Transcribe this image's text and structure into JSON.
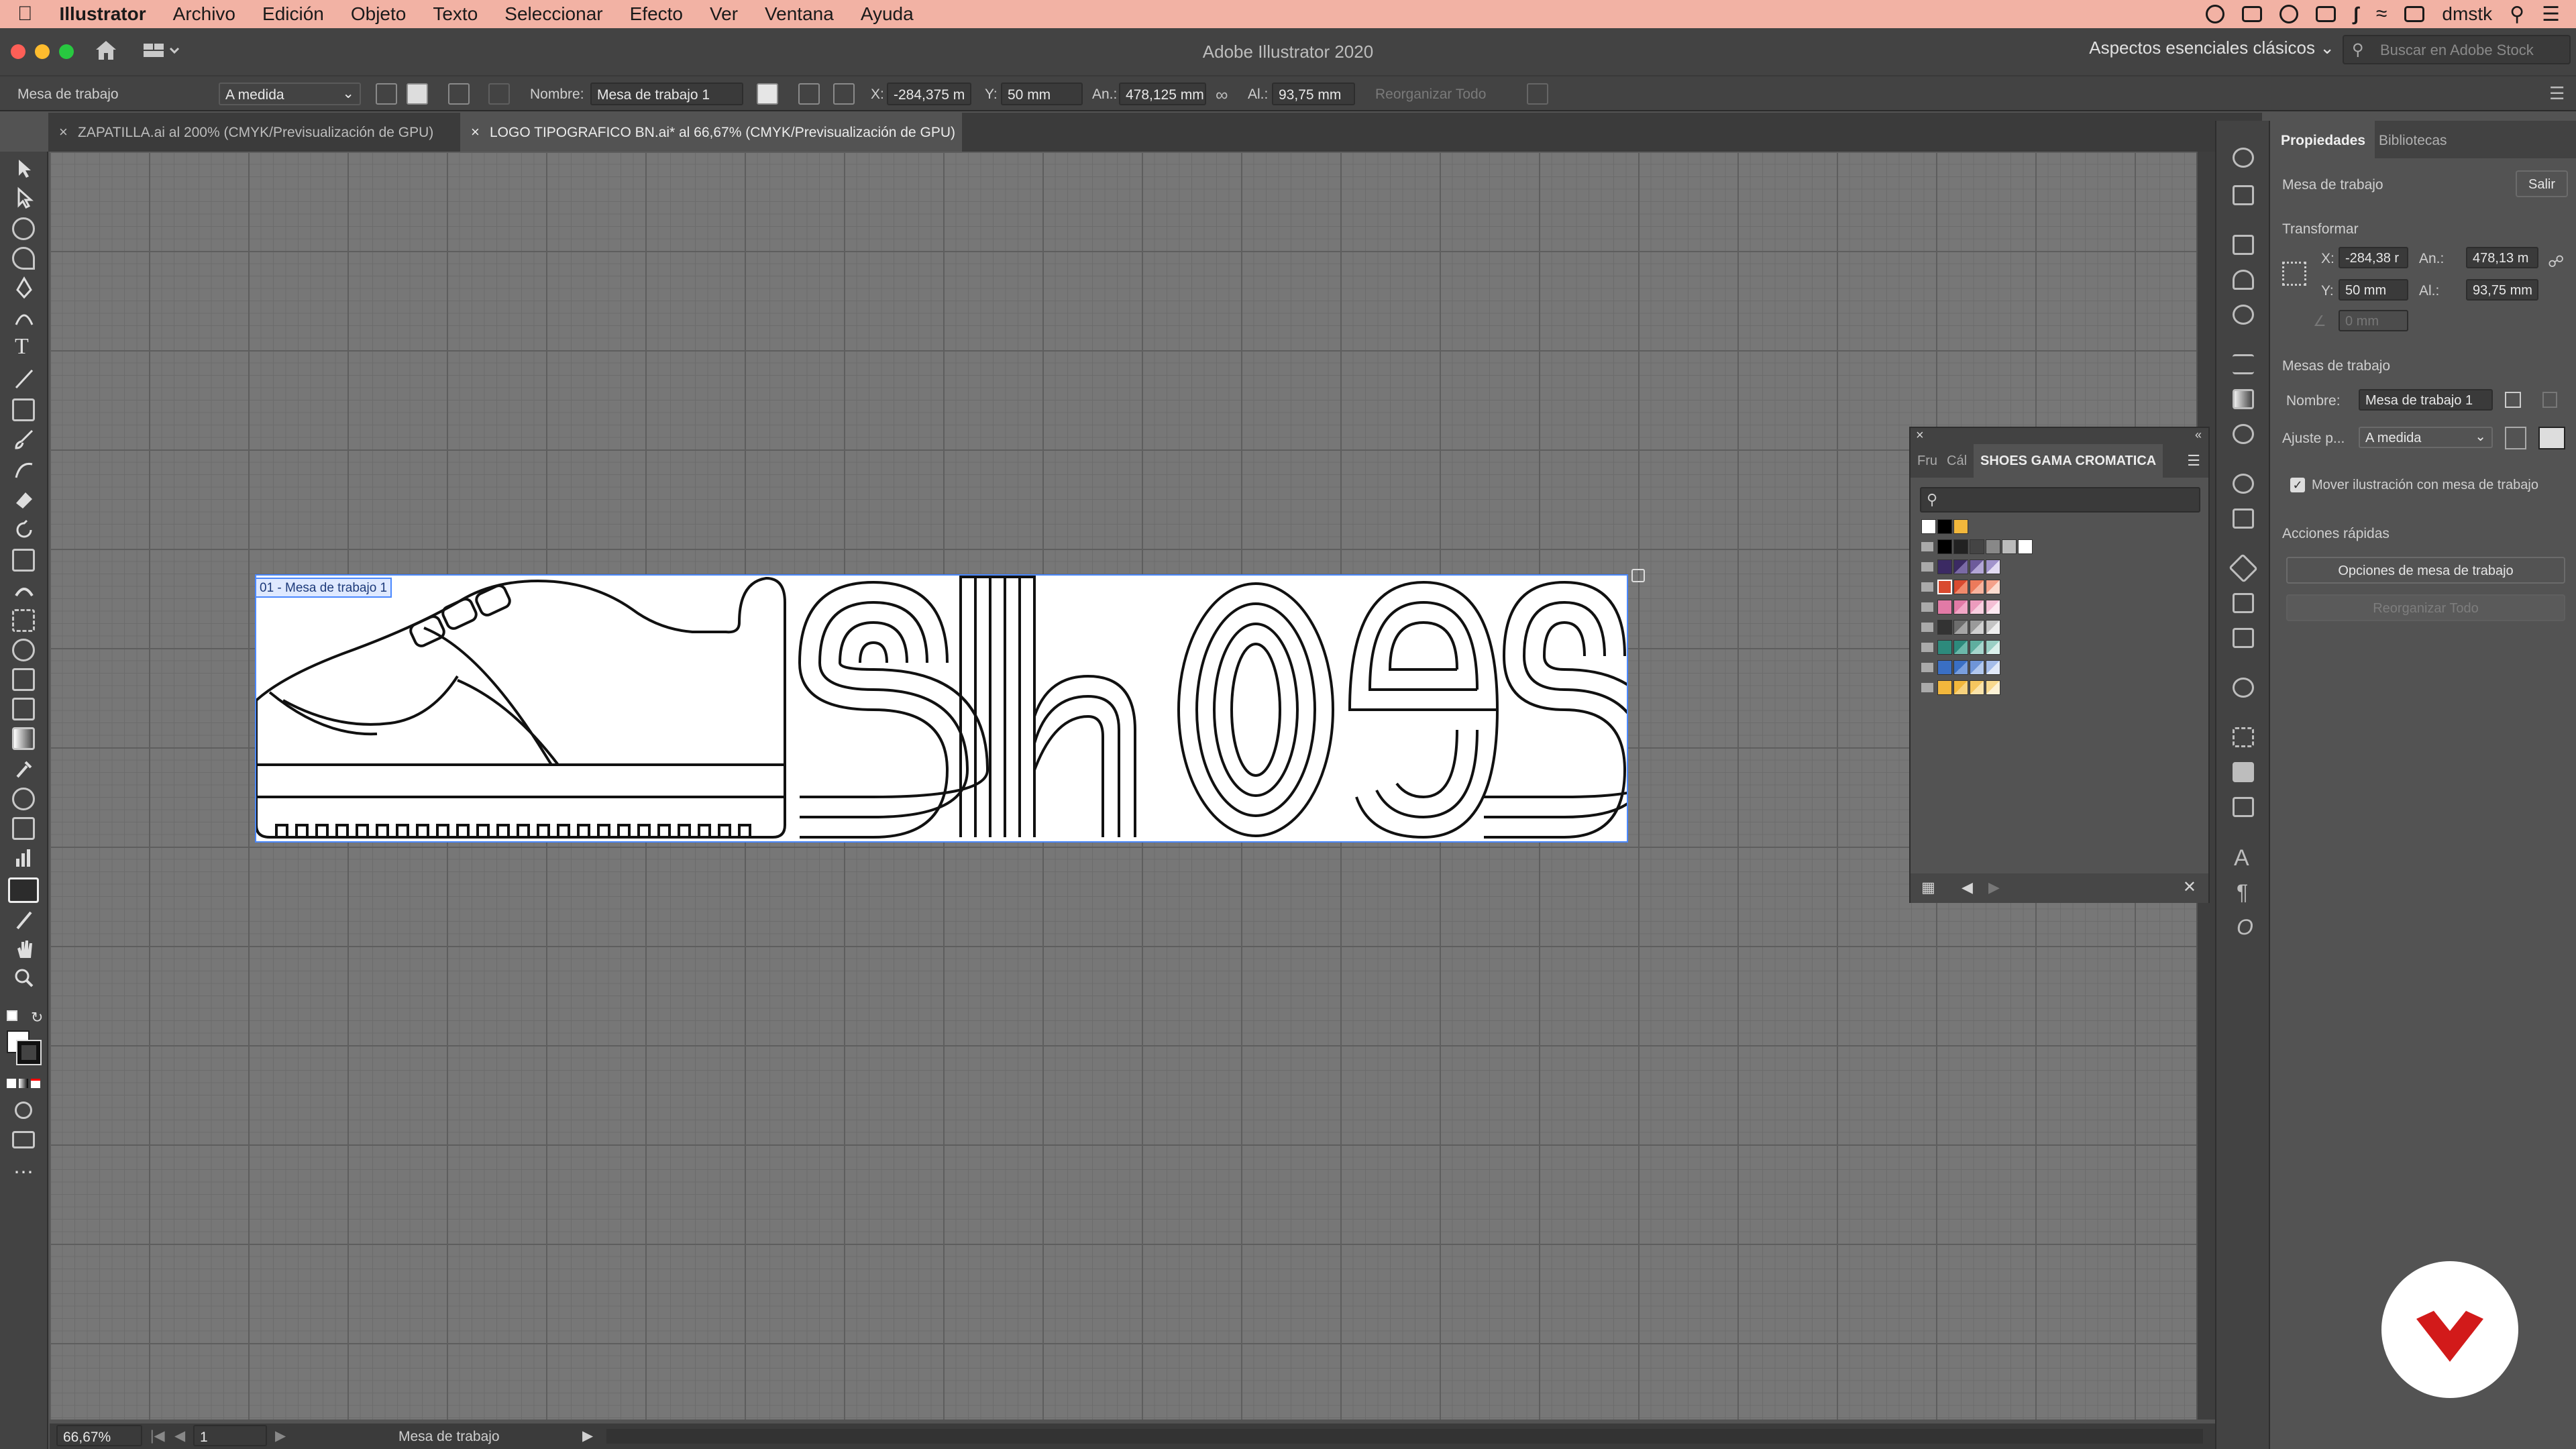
{
  "menubar": {
    "app": "Illustrator",
    "items": [
      "Archivo",
      "Edición",
      "Objeto",
      "Texto",
      "Seleccionar",
      "Efecto",
      "Ver",
      "Ventana",
      "Ayuda"
    ],
    "user": "dmstk"
  },
  "titlebar": {
    "title": "Adobe Illustrator 2020",
    "workspace": "Aspectos esenciales clásicos",
    "stock_placeholder": "Buscar en Adobe Stock"
  },
  "controlbar": {
    "artboard_label": "Mesa de trabajo",
    "preset": "A medida",
    "name_label": "Nombre:",
    "name_value": "Mesa de trabajo 1",
    "x_label": "X:",
    "x_value": "-284,375 m",
    "y_label": "Y:",
    "y_value": "50 mm",
    "w_label": "An.:",
    "w_value": "478,125 mm",
    "h_label": "Al.:",
    "h_value": "93,75 mm",
    "rearrange": "Reorganizar  Todo"
  },
  "tabs": [
    {
      "label": "ZAPATILLA.ai al 200% (CMYK/Previsualización de GPU)",
      "active": false
    },
    {
      "label": "LOGO TIPOGRAFICO BN.ai* al 66,67% (CMYK/Previsualización de GPU)",
      "active": true
    }
  ],
  "canvas": {
    "artboard_name": "01 - Mesa de trabajo 1"
  },
  "statusbar": {
    "zoom": "66,67%",
    "page": "1",
    "mode": "Mesa de trabajo"
  },
  "swatches_panel": {
    "tabs": [
      "Fru",
      "Cál",
      "SHOES GAMA CROMATICA"
    ],
    "colors": {
      "purple": "#3b2a63",
      "red": "#d94a2f",
      "pink": "#e27aa6",
      "grey": "#6d6d6d",
      "teal": "#2d8a7c",
      "blue": "#3a6fc4",
      "yellow": "#f2b73c"
    }
  },
  "properties": {
    "tabs": [
      "Propiedades",
      "Bibliotecas"
    ],
    "section_artboard": "Mesa de trabajo",
    "exit_button": "Salir",
    "section_transform": "Transformar",
    "x_label": "X:",
    "x_value": "-284,38 r",
    "w_label": "An.:",
    "w_value": "478,13 m",
    "y_label": "Y:",
    "y_value": "50 mm",
    "h_label": "Al.:",
    "h_value": "93,75 mm",
    "angle_value": "0 mm",
    "section_artboards": "Mesas de trabajo",
    "name_label": "Nombre:",
    "name_value": "Mesa de trabajo 1",
    "fit_label": "Ajuste p...",
    "fit_value": "A medida",
    "move_art_checkbox": "Mover ilustración con mesa de trabajo",
    "section_quick": "Acciones rápidas",
    "artboard_options_button": "Opciones de mesa de trabajo",
    "rearrange_button": "Reorganizar  Todo"
  }
}
